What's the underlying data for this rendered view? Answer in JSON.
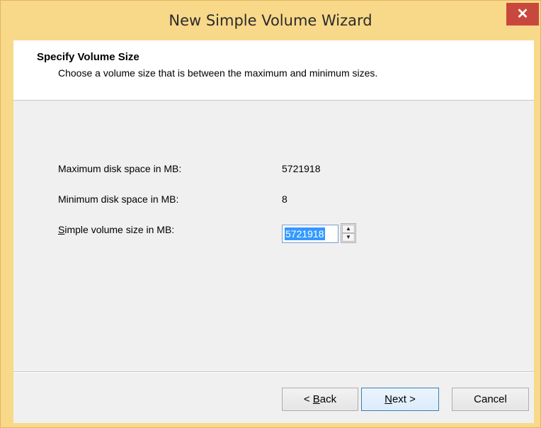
{
  "window": {
    "title": "New Simple Volume Wizard",
    "close_glyph": "✕"
  },
  "header": {
    "title": "Specify Volume Size",
    "subtitle": "Choose a volume size that is between the maximum and minimum sizes."
  },
  "fields": {
    "max_label": "Maximum disk space in MB:",
    "max_value": "5721918",
    "min_label": "Minimum disk space in MB:",
    "min_value": "8",
    "size_label_accel": "S",
    "size_label_rest": "imple volume size in MB:",
    "size_value": "5721918"
  },
  "spinner": {
    "up_glyph": "▲",
    "down_glyph": "▼"
  },
  "buttons": {
    "back_prefix": "< ",
    "back_accel": "B",
    "back_rest": "ack",
    "next_accel": "N",
    "next_rest": "ext >",
    "cancel": "Cancel"
  },
  "colors": {
    "title_bar": "#f8d98a",
    "close_button": "#c9483d",
    "selection": "#3399ff"
  }
}
